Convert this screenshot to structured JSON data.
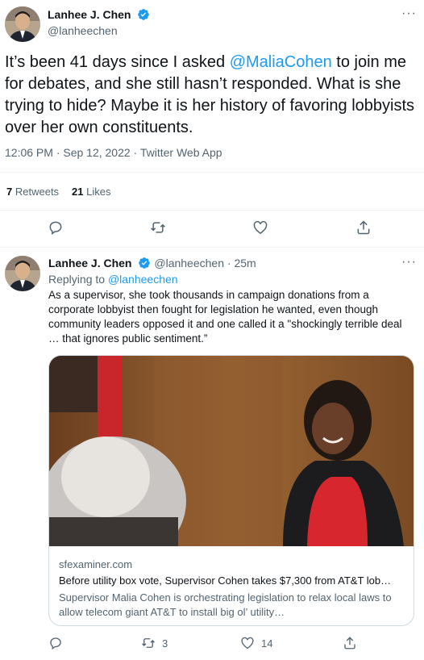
{
  "main_tweet": {
    "author_name": "Lanhee J. Chen",
    "author_handle": "@lanheechen",
    "more_label": "···",
    "text_before": "It’s been 41 days since I asked ",
    "mention": "@MaliaCohen",
    "text_after": " to join me for debates, and she still hasn’t responded. What is she trying to hide? Maybe it is her history of favoring lobbyists over her own constituents.",
    "timestamp": "12:06 PM · Sep 12, 2022 · Twitter Web App",
    "retweets_count": "7",
    "retweets_label": "Retweets",
    "likes_count": "21",
    "likes_label": "Likes"
  },
  "reply": {
    "author_name": "Lanhee J. Chen",
    "author_handle": "@lanheechen",
    "time": " · 25m",
    "more_label": "···",
    "replying_prefix": "Replying to ",
    "replying_to": "@lanheechen",
    "text": "As a supervisor, she took thousands in campaign donations from a corporate lobbyist then fought for legislation he wanted, even though community leaders opposed it and one called it a \"shockingly terrible deal … that ignores public sentiment.”",
    "card": {
      "domain": "sfexaminer.com",
      "title": "Before utility box vote, Supervisor Cohen takes $7,300 from AT&T lob…",
      "description": "Supervisor Malia Cohen is orchestrating legislation to relax local laws to allow telecom giant AT&T to install big ol’ utility…"
    },
    "retweet_count": "3",
    "like_count": "14"
  },
  "icons": {
    "reply": "speech-bubble-icon",
    "retweet": "retweet-arrows-icon",
    "like": "heart-icon",
    "share": "share-upload-icon",
    "verified": "verified-badge-icon"
  },
  "colors": {
    "accent": "#1d9bf0",
    "muted": "#536471",
    "text": "#0f1419",
    "divider": "#eff3f4"
  }
}
